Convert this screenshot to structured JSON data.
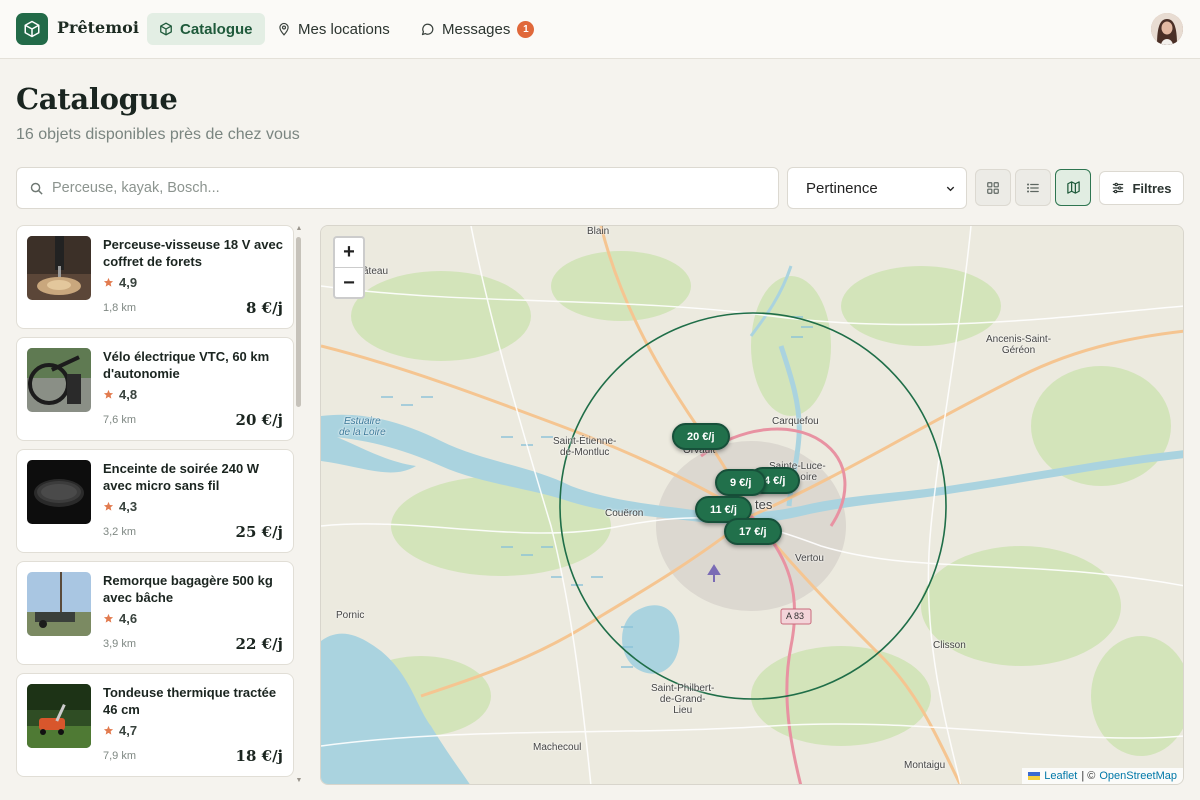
{
  "brand": {
    "name": "Prêtemoi"
  },
  "nav": {
    "catalogue": "Catalogue",
    "locations": "Mes locations",
    "messages": "Messages",
    "messages_badge": "1"
  },
  "page": {
    "title": "Catalogue",
    "subtitle": "16 objets disponibles près de chez vous"
  },
  "search": {
    "placeholder": "Perceuse, kayak, Bosch..."
  },
  "sort": {
    "selected": "Pertinence"
  },
  "filters_label": "Filtres",
  "items": [
    {
      "title": "Perceuse-visseuse 18 V avec coffret de forets",
      "rating": "4,9",
      "distance": "1,8 km",
      "price": "8 €/j"
    },
    {
      "title": "Vélo électrique VTC, 60 km d'autonomie",
      "rating": "4,8",
      "distance": "7,6 km",
      "price": "20 €/j"
    },
    {
      "title": "Enceinte de soirée 240 W avec micro sans fil",
      "rating": "4,3",
      "distance": "3,2 km",
      "price": "25 €/j"
    },
    {
      "title": "Remorque bagagère 500 kg avec bâche",
      "rating": "4,6",
      "distance": "3,9 km",
      "price": "22 €/j"
    },
    {
      "title": "Tondeuse thermique tractée 46 cm",
      "rating": "4,7",
      "distance": "7,9 km",
      "price": "18 €/j"
    }
  ],
  "map": {
    "zoom_in": "+",
    "zoom_out": "−",
    "pins": [
      "20 €/j",
      "9 €/j",
      "4 €/j",
      "11 €/j",
      "17 €/j"
    ],
    "places": {
      "blain": "Blain",
      "chateau": "âteau",
      "ancenis": "Ancenis-Saint-\nGéréon",
      "estuaire": "Estuaire\nde la Loire",
      "st_etienne": "Saint-Étienne-\nde-Montluc",
      "orvault": "Orvault",
      "carquefou": "Carquefou",
      "st_luce": "Sainte-Luce-\nsur-Loire",
      "nantes": "tes",
      "coueron": "Couëron",
      "vertou": "Vertou",
      "a83": "A 83",
      "pornic": "Pornic",
      "clisson": "Clisson",
      "st_philbert": "Saint-Philbert-\nde-Grand-\nLieu",
      "machecoul": "Machecoul",
      "montaigu": "Montaigu"
    },
    "attribution_leaflet": "Leaflet",
    "attribution_sep": "| ©",
    "attribution_osm": "OpenStreetMap"
  },
  "colors": {
    "accent": "#226a48",
    "badge": "#e0683a",
    "star": "#e27b4f"
  }
}
